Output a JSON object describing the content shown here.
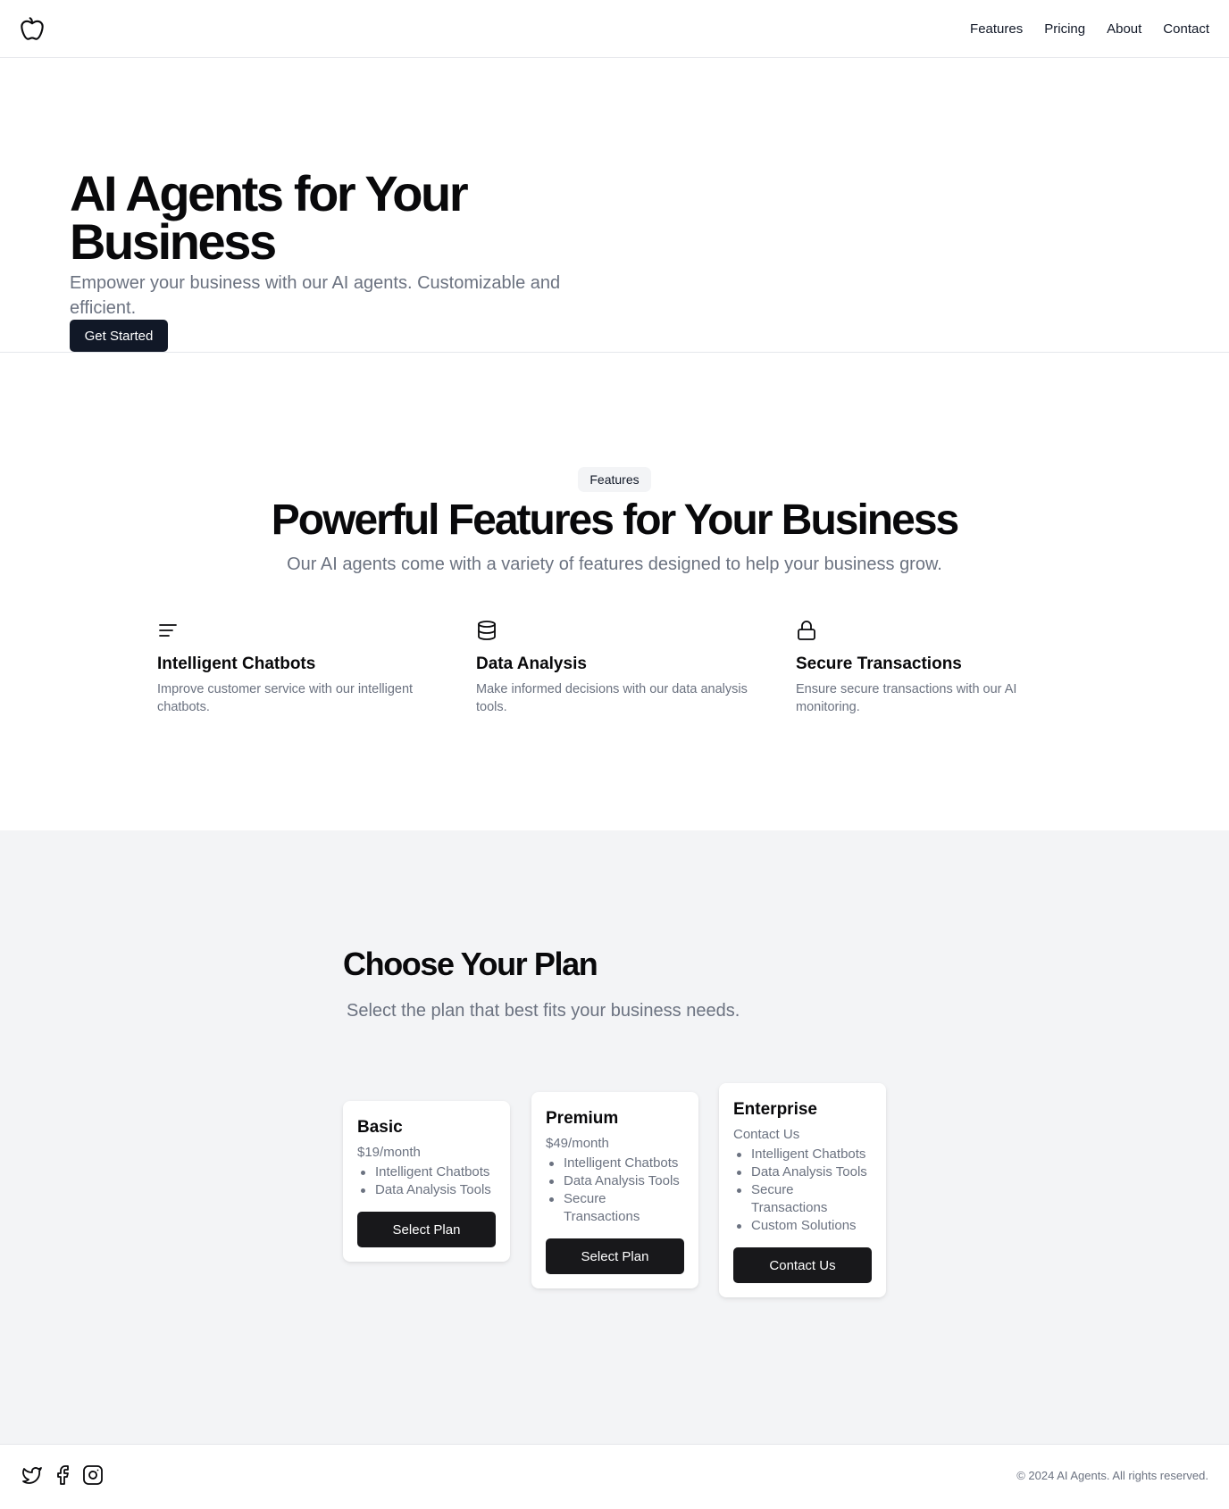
{
  "header": {
    "logo_icon": "apple-logo-icon",
    "nav": [
      "Features",
      "Pricing",
      "About",
      "Contact"
    ]
  },
  "hero": {
    "title": "AI Agents for Your Business",
    "subtitle": "Empower your business with our AI agents. Customizable and efficient.",
    "cta": "Get Started"
  },
  "features": {
    "badge": "Features",
    "title": "Powerful Features for Your Business",
    "subtitle": "Our AI agents come with a variety of features designed to help your business grow.",
    "items": [
      {
        "icon": "lines-icon",
        "title": "Intelligent Chatbots",
        "description": "Improve customer service with our intelligent chatbots."
      },
      {
        "icon": "database-icon",
        "title": "Data Analysis",
        "description": "Make informed decisions with our data analysis tools."
      },
      {
        "icon": "lock-icon",
        "title": "Secure Transactions",
        "description": "Ensure secure transactions with our AI monitoring."
      }
    ]
  },
  "pricing": {
    "title": "Choose Your Plan",
    "subtitle": "Select the plan that best fits your business needs.",
    "plans": [
      {
        "name": "Basic",
        "price": "$19/month",
        "features": [
          "Intelligent Chatbots",
          "Data Analysis Tools"
        ],
        "button": "Select Plan"
      },
      {
        "name": "Premium",
        "price": "$49/month",
        "features": [
          "Intelligent Chatbots",
          "Data Analysis Tools",
          "Secure Transactions"
        ],
        "button": "Select Plan"
      },
      {
        "name": "Enterprise",
        "price": "Contact Us",
        "features": [
          "Intelligent Chatbots",
          "Data Analysis Tools",
          "Secure Transactions",
          "Custom Solutions"
        ],
        "button": "Contact Us"
      }
    ]
  },
  "footer": {
    "social_icons": [
      "twitter-icon",
      "facebook-icon",
      "instagram-icon"
    ],
    "copyright": "© 2024 AI Agents. All rights reserved."
  },
  "colors": {
    "primary": "#111827",
    "button_dark": "#18181b",
    "muted_text": "#6b7280",
    "section_bg": "#f3f4f6",
    "border": "#e5e7eb"
  }
}
